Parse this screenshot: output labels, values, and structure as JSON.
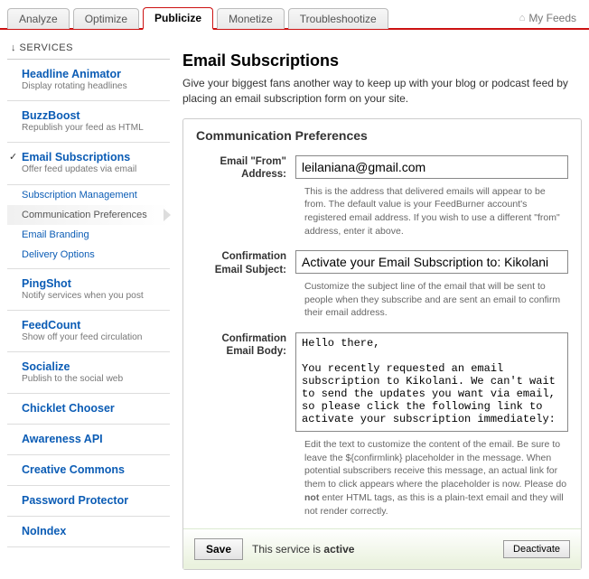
{
  "tabs": {
    "analyze": "Analyze",
    "optimize": "Optimize",
    "publicize": "Publicize",
    "monetize": "Monetize",
    "troubleshootize": "Troubleshootize"
  },
  "myfeeds_label": "My Feeds",
  "sidebar": {
    "header": "↓ SERVICES",
    "headline_animator": {
      "title": "Headline Animator",
      "desc": "Display rotating headlines"
    },
    "buzzboost": {
      "title": "BuzzBoost",
      "desc": "Republish your feed as HTML"
    },
    "email_subscriptions": {
      "title": "Email Subscriptions",
      "desc": "Offer feed updates via email"
    },
    "sub_subscription_mgmt": "Subscription Management",
    "sub_comm_prefs": "Communication Preferences",
    "sub_email_branding": "Email Branding",
    "sub_delivery_options": "Delivery Options",
    "pingshot": {
      "title": "PingShot",
      "desc": "Notify services when you post"
    },
    "feedcount": {
      "title": "FeedCount",
      "desc": "Show off your feed circulation"
    },
    "socialize": {
      "title": "Socialize",
      "desc": "Publish to the social web"
    },
    "chicklet": {
      "title": "Chicklet Chooser"
    },
    "awareness": {
      "title": "Awareness API"
    },
    "cc": {
      "title": "Creative Commons"
    },
    "password": {
      "title": "Password Protector"
    },
    "noindex": {
      "title": "NoIndex"
    }
  },
  "page": {
    "title": "Email Subscriptions",
    "intro": "Give your biggest fans another way to keep up with your blog or podcast feed by placing an email subscription form on your site."
  },
  "panel": {
    "heading": "Communication Preferences",
    "from_label": "Email \"From\" Address:",
    "from_value": "leilaniana@gmail.com",
    "from_help": "This is the address that delivered emails will appear to be from. The default value is your FeedBurner account's registered email address. If you wish to use a different \"from\" address, enter it above.",
    "subject_label": "Confirmation Email Subject:",
    "subject_value": "Activate your Email Subscription to: Kikolani",
    "subject_help": "Customize the subject line of the email that will be sent to people when they subscribe and are sent an email to confirm their email address.",
    "body_label": "Confirmation Email Body:",
    "body_value": "Hello there,\n\nYou recently requested an email subscription to Kikolani. We can't wait to send the updates you want via email, so please click the following link to activate your subscription immediately:",
    "body_help_pre": "Edit the text to customize the content of the email. Be sure to leave the ${confirmlink} placeholder in the message. When potential subscribers receive this message, an actual link for them to click appears where the placeholder is now. Please do ",
    "body_help_not": "not",
    "body_help_post": " enter HTML tags, as this is a plain-text email and they will not render correctly."
  },
  "savebar": {
    "save": "Save",
    "status_pre": "This service is ",
    "status_state": "active",
    "deactivate": "Deactivate"
  }
}
